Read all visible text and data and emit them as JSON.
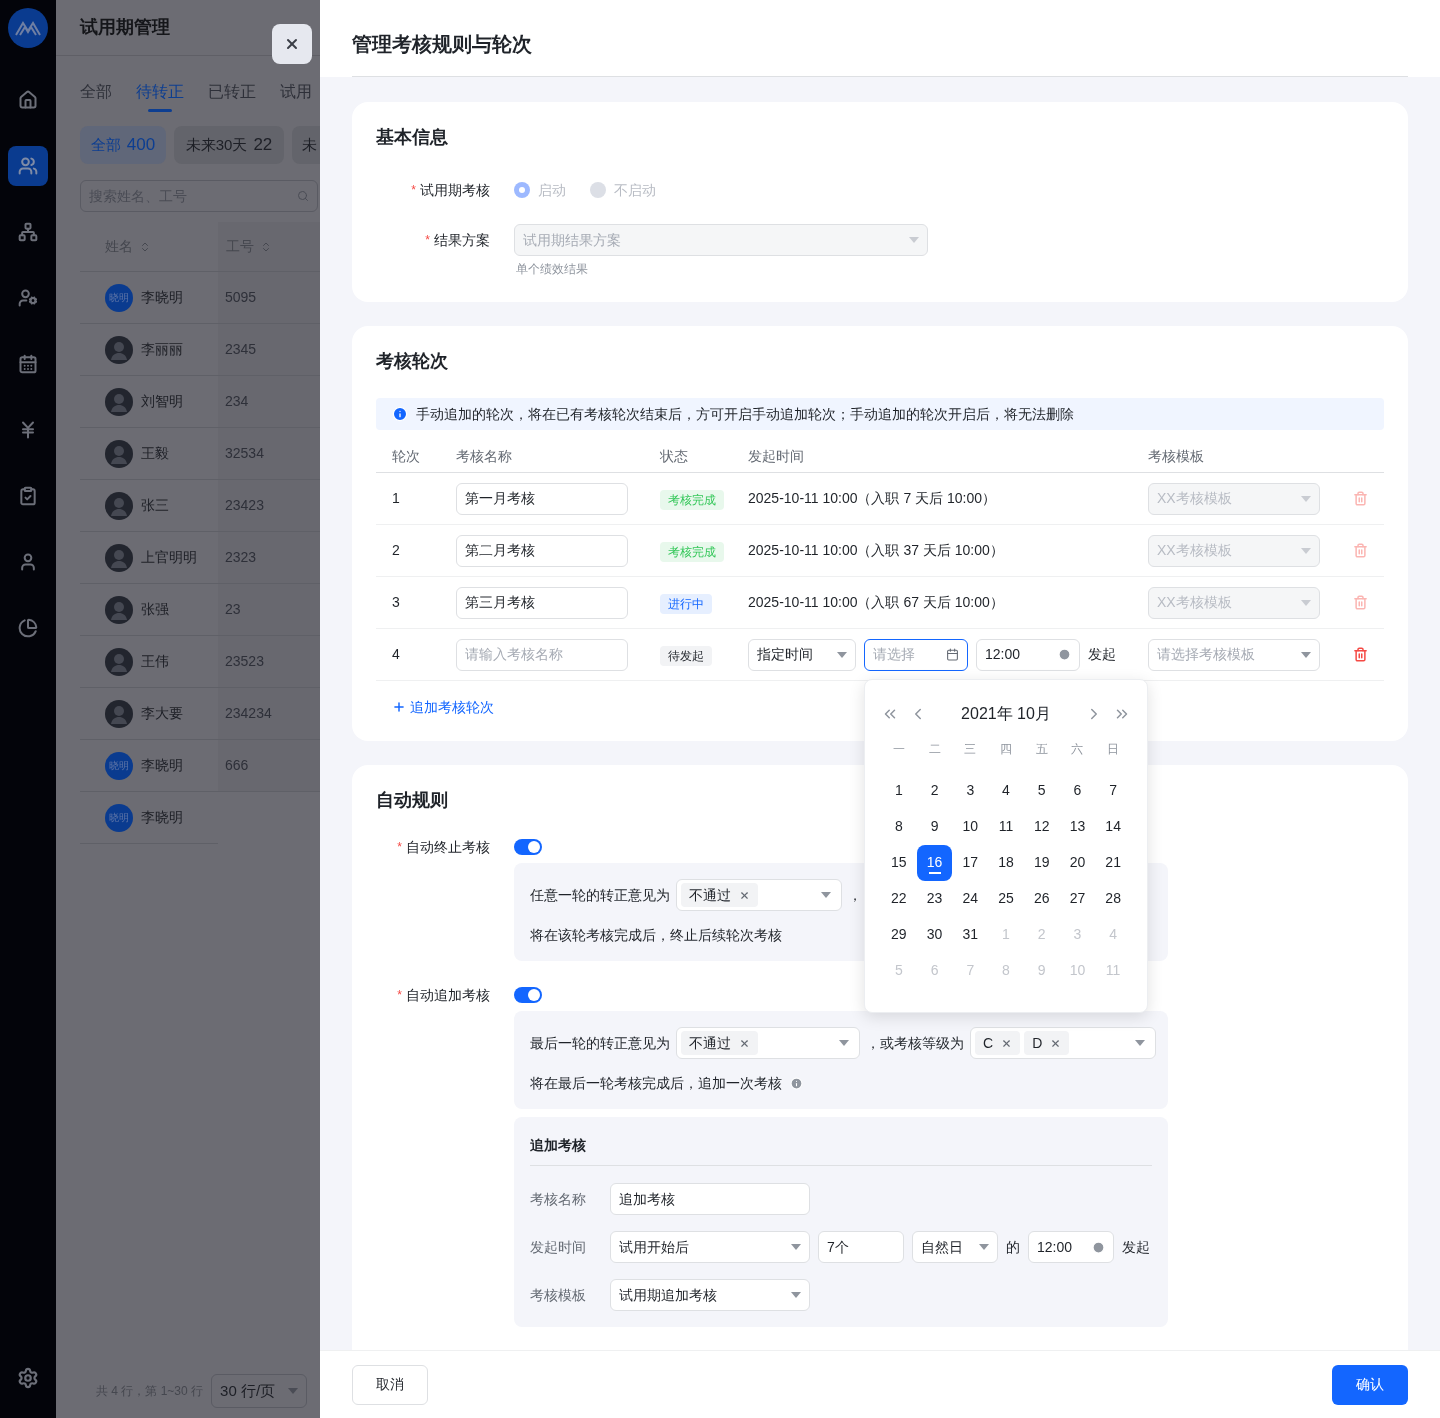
{
  "app_nav": [
    {
      "selected": false
    },
    {
      "selected": true
    },
    {
      "selected": false
    },
    {
      "selected": false
    },
    {
      "selected": false
    },
    {
      "selected": false
    },
    {
      "selected": false
    },
    {
      "selected": false
    },
    {
      "selected": false
    }
  ],
  "page": {
    "title": "试用期管理",
    "tabs": [
      {
        "label": "全部",
        "selected": false
      },
      {
        "label": "待转正",
        "selected": true
      },
      {
        "label": "已转正",
        "selected": false
      },
      {
        "label": "试用",
        "selected": false
      }
    ],
    "filters": [
      {
        "label": "全部",
        "count": "400",
        "selected": true
      },
      {
        "label": "未来30天",
        "count": "22",
        "selected": false
      },
      {
        "label": "未",
        "selected": false
      }
    ],
    "search": {
      "placeholder": "搜索姓名、工号"
    },
    "table": {
      "columns": [
        "姓名",
        "工号"
      ],
      "rows": [
        {
          "name": "李晓明",
          "id": "5095",
          "avatar": {
            "kind": "initials",
            "text": "晓明"
          }
        },
        {
          "name": "李丽丽",
          "id": "2345",
          "avatar": {
            "kind": "photo"
          }
        },
        {
          "name": "刘智明",
          "id": "234",
          "avatar": {
            "kind": "photo"
          }
        },
        {
          "name": "王毅",
          "id": "32534",
          "avatar": {
            "kind": "photo"
          }
        },
        {
          "name": "张三",
          "id": "23423",
          "avatar": {
            "kind": "photo"
          }
        },
        {
          "name": "上官明明",
          "id": "2323",
          "avatar": {
            "kind": "photo"
          }
        },
        {
          "name": "张强",
          "id": "23",
          "avatar": {
            "kind": "photo"
          }
        },
        {
          "name": "王伟",
          "id": "23523",
          "avatar": {
            "kind": "photo"
          }
        },
        {
          "name": "李大要",
          "id": "234234",
          "avatar": {
            "kind": "photo"
          }
        },
        {
          "name": "李晓明",
          "id": "666",
          "avatar": {
            "kind": "initials",
            "text": "晓明"
          }
        },
        {
          "name": "李晓明",
          "avatar": {
            "kind": "initials",
            "text": "晓明"
          }
        }
      ]
    },
    "pagination": {
      "summary": "共 4 行，第 1~30 行",
      "page_size": "30 行/页"
    }
  },
  "drawer": {
    "title": "管理考核规则与轮次",
    "basic_info": {
      "title": "基本信息",
      "assessment": {
        "required_mark": "*",
        "label": "试用期考核",
        "disabled": true,
        "options": [
          {
            "label": "启动",
            "selected": true
          },
          {
            "label": "不启动",
            "selected": false
          }
        ]
      },
      "result_plan": {
        "required_mark": "*",
        "label": "结果方案",
        "placeholder": "试用期结果方案",
        "disabled": true,
        "help": "单个绩效结果"
      }
    },
    "rounds": {
      "title": "考核轮次",
      "notice": "手动追加的轮次，将在已有考核轮次结束后，方可开启手动追加轮次；手动追加的轮次开启后，将无法删除",
      "columns": [
        "轮次",
        "考核名称",
        "状态",
        "发起时间",
        "考核模板"
      ],
      "rows": [
        {
          "kind": "scheduled",
          "index": "1",
          "name": "第一月考核",
          "status": {
            "label": "考核完成",
            "kind": "done"
          },
          "time": "2025-10-11 10:00（入职 7 天后 10:00）",
          "template": {
            "value": "XX考核模板",
            "disabled": true
          },
          "delete_disabled": true
        },
        {
          "kind": "scheduled",
          "index": "2",
          "name": "第二月考核",
          "status": {
            "label": "考核完成",
            "kind": "done"
          },
          "time": "2025-10-11 10:00（入职 37 天后 10:00）",
          "template": {
            "value": "XX考核模板",
            "disabled": true
          },
          "delete_disabled": true
        },
        {
          "kind": "scheduled",
          "index": "3",
          "name": "第三月考核",
          "status": {
            "label": "进行中",
            "kind": "progress"
          },
          "time": "2025-10-11 10:00（入职 67 天后 10:00）",
          "template": {
            "value": "XX考核模板",
            "disabled": true
          },
          "delete_disabled": true
        },
        {
          "kind": "new",
          "index": "4",
          "name_placeholder": "请输入考核名称",
          "status": {
            "label": "待发起",
            "kind": "pending"
          },
          "trigger": {
            "mode": "指定时间",
            "date_placeholder": "请选择",
            "date_focused": true,
            "time": "12:00",
            "suffix": "发起"
          },
          "template": {
            "placeholder": "请选择考核模板",
            "disabled": false
          },
          "delete_disabled": false
        }
      ],
      "add_link": "追加考核轮次",
      "calendar": {
        "title": "2021年 10月",
        "weekdays": [
          "一",
          "二",
          "三",
          "四",
          "五",
          "六",
          "日"
        ],
        "days": [
          {
            "label": "1",
            "in_month": true,
            "selected": false
          },
          {
            "label": "2",
            "in_month": true,
            "selected": false
          },
          {
            "label": "3",
            "in_month": true,
            "selected": false
          },
          {
            "label": "4",
            "in_month": true,
            "selected": false
          },
          {
            "label": "5",
            "in_month": true,
            "selected": false
          },
          {
            "label": "6",
            "in_month": true,
            "selected": false
          },
          {
            "label": "7",
            "in_month": true,
            "selected": false
          },
          {
            "label": "8",
            "in_month": true,
            "selected": false
          },
          {
            "label": "9",
            "in_month": true,
            "selected": false
          },
          {
            "label": "10",
            "in_month": true,
            "selected": false
          },
          {
            "label": "11",
            "in_month": true,
            "selected": false
          },
          {
            "label": "12",
            "in_month": true,
            "selected": false
          },
          {
            "label": "13",
            "in_month": true,
            "selected": false
          },
          {
            "label": "14",
            "in_month": true,
            "selected": false
          },
          {
            "label": "15",
            "in_month": true,
            "selected": false
          },
          {
            "label": "16",
            "in_month": true,
            "selected": true
          },
          {
            "label": "17",
            "in_month": true,
            "selected": false
          },
          {
            "label": "18",
            "in_month": true,
            "selected": false
          },
          {
            "label": "19",
            "in_month": true,
            "selected": false
          },
          {
            "label": "20",
            "in_month": true,
            "selected": false
          },
          {
            "label": "21",
            "in_month": true,
            "selected": false
          },
          {
            "label": "22",
            "in_month": true,
            "selected": false
          },
          {
            "label": "23",
            "in_month": true,
            "selected": false
          },
          {
            "label": "24",
            "in_month": true,
            "selected": false
          },
          {
            "label": "25",
            "in_month": true,
            "selected": false
          },
          {
            "label": "26",
            "in_month": true,
            "selected": false
          },
          {
            "label": "27",
            "in_month": true,
            "selected": false
          },
          {
            "label": "28",
            "in_month": true,
            "selected": false
          },
          {
            "label": "29",
            "in_month": true,
            "selected": false
          },
          {
            "label": "30",
            "in_month": true,
            "selected": false
          },
          {
            "label": "31",
            "in_month": true,
            "selected": false
          },
          {
            "label": "1",
            "in_month": false,
            "selected": false
          },
          {
            "label": "2",
            "in_month": false,
            "selected": false
          },
          {
            "label": "3",
            "in_month": false,
            "selected": false
          },
          {
            "label": "4",
            "in_month": false,
            "selected": false
          },
          {
            "label": "5",
            "in_month": false,
            "selected": false
          },
          {
            "label": "6",
            "in_month": false,
            "selected": false
          },
          {
            "label": "7",
            "in_month": false,
            "selected": false
          },
          {
            "label": "8",
            "in_month": false,
            "selected": false
          },
          {
            "label": "9",
            "in_month": false,
            "selected": false
          },
          {
            "label": "10",
            "in_month": false,
            "selected": false
          },
          {
            "label": "11",
            "in_month": false,
            "selected": false
          }
        ]
      }
    },
    "auto_rules": {
      "title": "自动规则",
      "rules": [
        {
          "required_mark": "*",
          "label": "自动终止考核",
          "on": true,
          "conditions": [
            {
              "kind": "text",
              "text": "任意一轮的转正意见为"
            },
            {
              "kind": "select",
              "tags": [
                "不通过"
              ]
            },
            {
              "kind": "text",
              "text": "，"
            }
          ],
          "note": "将在该轮考核完成后，终止后续轮次考核",
          "note_info": false
        },
        {
          "required_mark": "*",
          "label": "自动追加考核",
          "on": true,
          "conditions": [
            {
              "kind": "text",
              "text": "最后一轮的转正意见为"
            },
            {
              "kind": "select",
              "tags": [
                "不通过"
              ]
            },
            {
              "kind": "text",
              "text": "，或考核等级为"
            },
            {
              "kind": "select",
              "tags": [
                "C",
                "D"
              ]
            }
          ],
          "note": "将在最后一轮考核完成后，追加一次考核",
          "note_info": true,
          "extra": {
            "title": "追加考核",
            "rows": [
              {
                "label": "考核名称",
                "controls": [
                  {
                    "kind": "input",
                    "value": "追加考核"
                  }
                ]
              },
              {
                "label": "发起时间",
                "controls": [
                  {
                    "kind": "select",
                    "value": "试用开始后"
                  },
                  {
                    "kind": "input",
                    "value": "7个"
                  },
                  {
                    "kind": "select",
                    "value": "自然日"
                  },
                  {
                    "kind": "text",
                    "text": "的"
                  },
                  {
                    "kind": "time",
                    "value": "12:00"
                  },
                  {
                    "kind": "text",
                    "text": "发起"
                  }
                ]
              },
              {
                "label": "考核模板",
                "controls": [
                  {
                    "kind": "select",
                    "value": "试用期追加考核"
                  }
                ]
              }
            ]
          }
        }
      ]
    },
    "footer": {
      "cancel": "取消",
      "confirm": "确认"
    }
  }
}
